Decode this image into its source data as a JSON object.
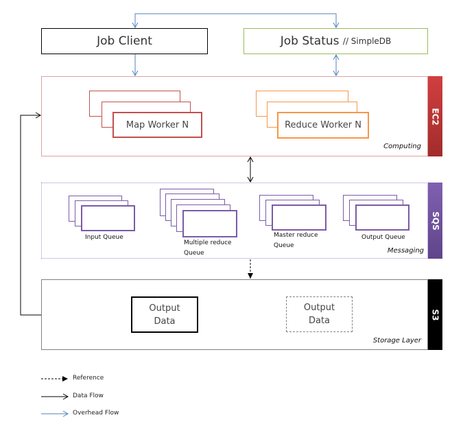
{
  "top": {
    "job_client": "Job Client",
    "job_status": "Job Status",
    "job_status_suffix": "// SimpleDB"
  },
  "ec2": {
    "label": "EC2",
    "caption": "Computing",
    "map_worker": "Map Worker N",
    "reduce_worker": "Reduce Worker N",
    "color": "#c0393b"
  },
  "sqs": {
    "label": "SQS",
    "caption": "Messaging",
    "color": "#7b5aa6",
    "queues": [
      {
        "line1": "Input Queue",
        "line2": ""
      },
      {
        "line1": "Multiple reduce",
        "line2": "Queue"
      },
      {
        "line1": "Master reduce",
        "line2": "Queue"
      },
      {
        "line1": "Output Queue",
        "line2": ""
      }
    ]
  },
  "s3": {
    "label": "S3",
    "caption": "Storage Layer",
    "color": "#000000",
    "data_solid": {
      "line1": "Output",
      "line2": "Data"
    },
    "data_dashed": {
      "line1": "Output",
      "line2": "Data"
    }
  },
  "legend": [
    {
      "label": "Reference",
      "style": "dashed",
      "color": "#000000"
    },
    {
      "label": "Data Flow",
      "style": "solid",
      "color": "#000000"
    },
    {
      "label": "Overhead Flow",
      "style": "solid",
      "color": "#4f81bd"
    }
  ]
}
